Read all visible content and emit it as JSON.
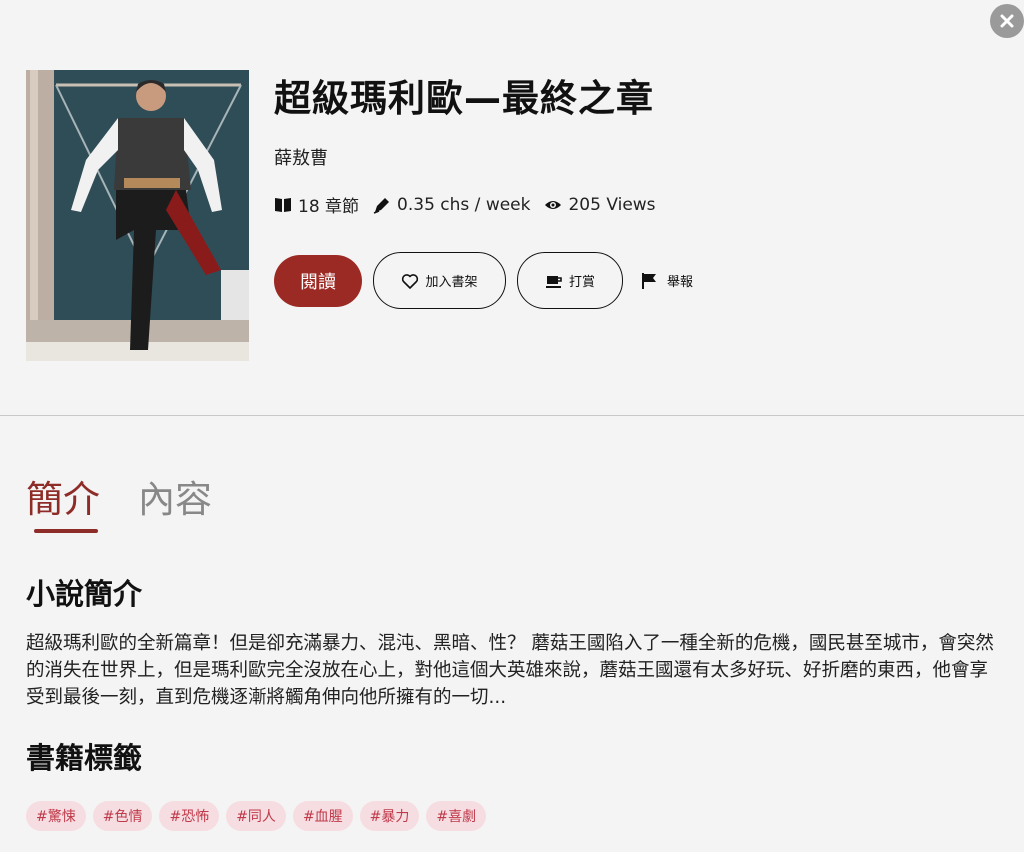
{
  "book": {
    "title": "超級瑪利歐—最終之章",
    "author": "薛敖曹",
    "chapters": "18 章節",
    "rate": "0.35 chs / week",
    "views": "205 Views"
  },
  "actions": {
    "read": "閱讀",
    "add_shelf": "加入書架",
    "tip": "打賞",
    "report": "舉報"
  },
  "tabs": [
    {
      "label": "簡介",
      "active": true
    },
    {
      "label": "內容",
      "active": false
    }
  ],
  "synopsis": {
    "heading": "小說簡介",
    "text": "超級瑪利歐的全新篇章！但是卻充滿暴力、混沌、黑暗、性？ 蘑菇王國陷入了一種全新的危機，國民甚至城市，會突然的消失在世界上，但是瑪利歐完全沒放在心上，對他這個大英雄來說，蘑菇王國還有太多好玩、好折磨的東西，他會享受到最後一刻，直到危機逐漸將觸角伸向他所擁有的一切..."
  },
  "tags_section": {
    "heading": "書籍標籤",
    "tags": [
      "#驚悚",
      "#色情",
      "#恐怖",
      "#同人",
      "#血腥",
      "#暴力",
      "#喜劇"
    ]
  },
  "colors": {
    "accent": "#9c2a24",
    "tag_bg": "#f6dde1",
    "tag_text": "#c03a4a"
  },
  "icons": {
    "close": "close-icon",
    "chapters": "book-icon",
    "rate": "pen-icon",
    "views": "eye-icon",
    "shelf": "heart-icon",
    "tip": "coffee-icon",
    "report": "flag-icon"
  }
}
